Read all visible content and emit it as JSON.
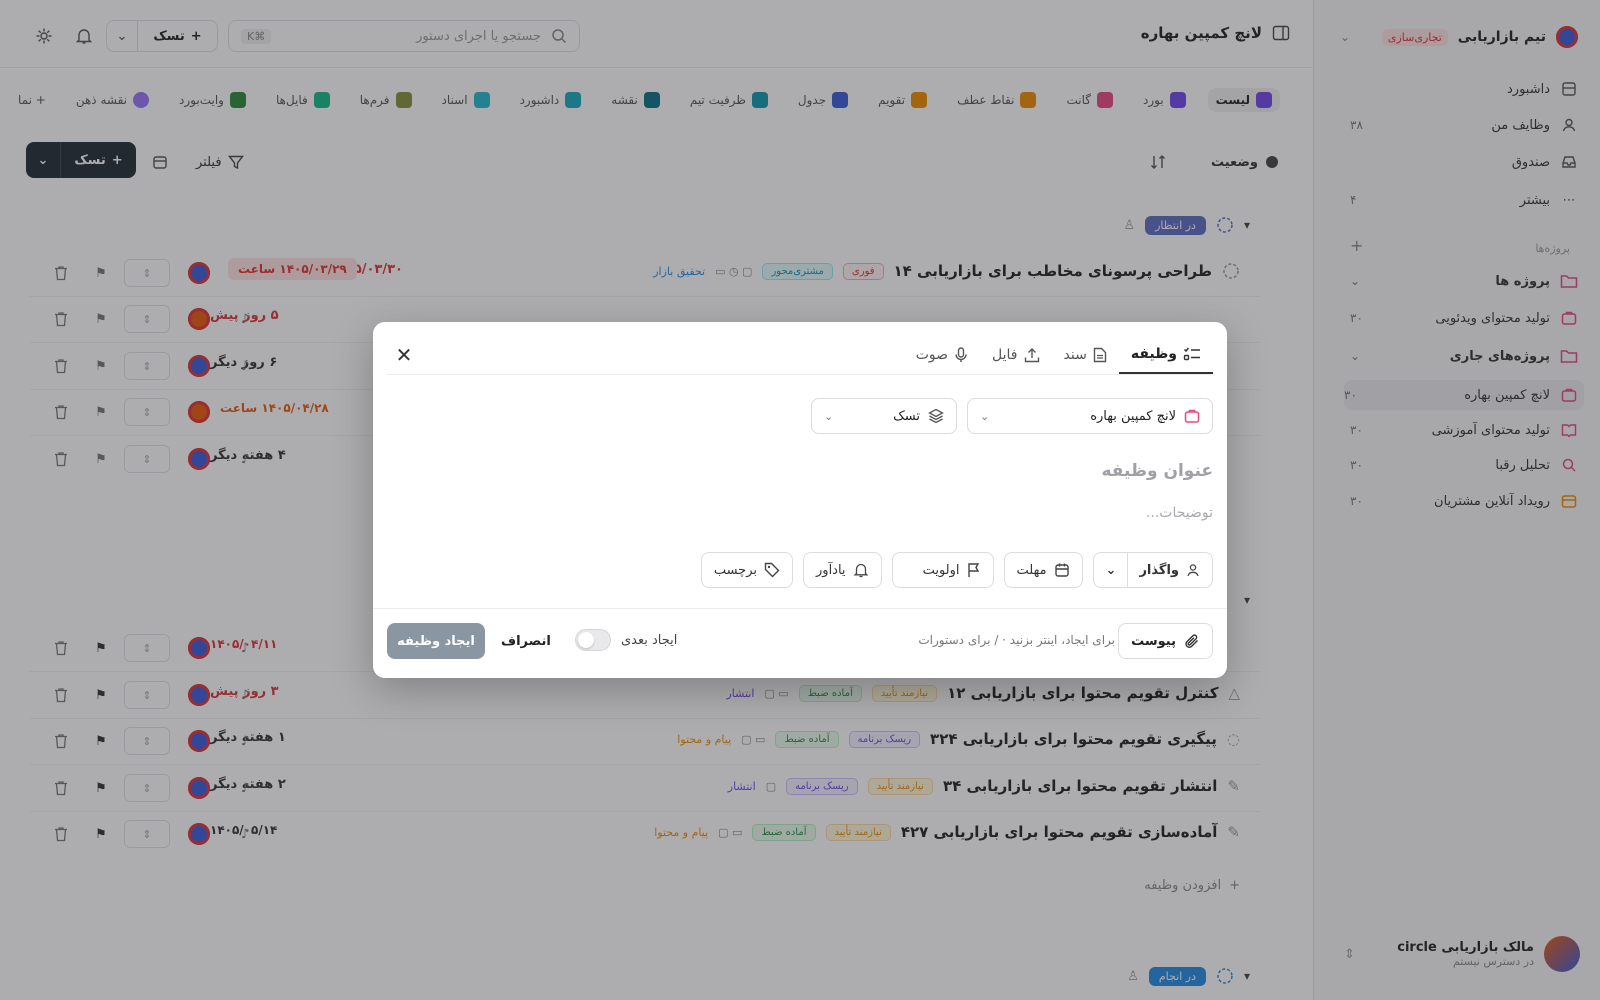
{
  "sidebar": {
    "workspace_name": "تیم بازاریابی",
    "workspace_badge": "تجاری‌سازی",
    "nav": [
      {
        "label": "داشبورد",
        "count": ""
      },
      {
        "label": "وظایف من",
        "count": "۳۸"
      },
      {
        "label": "صندوق",
        "count": ""
      },
      {
        "label": "بیشتر",
        "count": "۴"
      }
    ],
    "section_label": "پروژه‌ها",
    "folders": [
      {
        "label": "پروژه ها"
      },
      {
        "label": "پروژه‌های جاری"
      }
    ],
    "projects": [
      {
        "label": "تولید محتوای ویدئویی",
        "count": "۳۰",
        "color": "#e64980"
      },
      {
        "label": "لانچ کمپین بهاره",
        "count": "۳۰",
        "color": "#e64980"
      },
      {
        "label": "تولید محتوای آموزشی",
        "count": "۳۰",
        "color": "#e64980"
      },
      {
        "label": "تحلیل رقبا",
        "count": "۳۰",
        "color": "#e64980"
      },
      {
        "label": "رویداد آنلاین مشتریان",
        "count": "۳۰",
        "color": "#f08c00"
      }
    ],
    "user_name": "مالک بازاریابی circle",
    "user_role": "در دسترس نیستم"
  },
  "topbar": {
    "title": "لانچ کمپین بهاره",
    "search_placeholder": "جستجو یا اجرای دستور",
    "search_kbd": "⌘K",
    "new_label": "تسک"
  },
  "views": [
    {
      "label": "لیست",
      "color": "#7048e8",
      "active": true
    },
    {
      "label": "بورد",
      "color": "#7048e8"
    },
    {
      "label": "گانت",
      "color": "#e64980"
    },
    {
      "label": "نقاط عطف",
      "color": "#f08c00"
    },
    {
      "label": "تقویم",
      "color": "#f08c00"
    },
    {
      "label": "جدول",
      "color": "#3b5bdb"
    },
    {
      "label": "ظرفیت تیم",
      "color": "#1098ad"
    },
    {
      "label": "نقشه",
      "color": "#0b7285"
    },
    {
      "label": "داشبورد",
      "color": "#15aabf"
    },
    {
      "label": "اسناد",
      "color": "#22b8cf"
    },
    {
      "label": "فرم‌ها",
      "color": "#868e3e"
    },
    {
      "label": "فایل‌ها",
      "color": "#12b886"
    },
    {
      "label": "وایت‌بورد",
      "color": "#2b8a3e"
    },
    {
      "label": "نقشه ذهن",
      "color": "#9775fa"
    },
    {
      "label": "+ نما",
      "color": ""
    }
  ],
  "toolbar": {
    "status_label": "وضعیت",
    "filter_label": "فیلتر",
    "add_label": "تسک"
  },
  "groups": [
    {
      "label": "در انتظار",
      "color": "#5c6bc0"
    },
    {
      "label": "در انجام",
      "color": "#228be6"
    }
  ],
  "rows_top": [
    {
      "title": "طراحی پرسونای مخاطب برای بازاریابی ۱۴",
      "tag1": "فوری",
      "tag2": "مشتری‌محور",
      "link": "تحقیق بازار",
      "due": "۱۴۰۵/۰۳/۳۰",
      "pill": "۱۴۰۵/۰۳/۲۹ ساعت"
    },
    {
      "title": "",
      "due": "۵ روز پیش",
      "due_color": "#e03131"
    },
    {
      "title": "",
      "due": "۶ روز دیگر",
      "due_color": "#333"
    },
    {
      "title": "",
      "due": "۱۴۰۵/۰۴/۲۸ ساعت",
      "due_color": "#e8590c"
    },
    {
      "title": "",
      "due": "۴ هفته دیگر",
      "due_color": "#333"
    }
  ],
  "rows_bottom": [
    {
      "title": "",
      "due": "۱۴۰۵/۰۴/۱۱",
      "due_color": "#e03131"
    },
    {
      "title": "کنترل تقویم محتوا برای بازاریابی ۱۲",
      "tag1": "نیازمند تأیید",
      "tag2": "آماده ضبط",
      "link": "انتشار",
      "due": "۳ روز پیش",
      "due_color": "#e03131"
    },
    {
      "title": "پیگیری تقویم محتوا برای بازاریابی ۳۲۴",
      "tag1": "ریسک برنامه",
      "tag2": "آماده ضبط",
      "link": "پیام و محتوا",
      "due": "۱ هفته دیگر",
      "due_color": "#333"
    },
    {
      "title": "انتشار تقویم محتوا برای بازاریابی ۳۴",
      "tag1": "نیازمند تأیید",
      "tag2": "ریسک برنامه",
      "link": "انتشار",
      "due": "۲ هفته دیگر",
      "due_color": "#333"
    },
    {
      "title": "آماده‌سازی تقویم محتوا برای بازاریابی ۴۲۷",
      "tag1": "نیازمند تأیید",
      "tag2": "آماده ضبط",
      "link": "پیام و محتوا",
      "due": "۱۴۰۵/۰۵/۱۴",
      "due_color": "#333"
    }
  ],
  "add_task_label": "افزودن وظیفه",
  "modal": {
    "tabs": [
      {
        "label": "وظیفه",
        "icon": "task-list-icon",
        "active": true
      },
      {
        "label": "سند",
        "icon": "document-icon"
      },
      {
        "label": "فایل",
        "icon": "upload-icon"
      },
      {
        "label": "صوت",
        "icon": "microphone-icon"
      }
    ],
    "project_value": "لانچ کمپین بهاره",
    "type_value": "تسک",
    "title_placeholder": "عنوان وظیفه",
    "description_placeholder": "توضیحات...",
    "assign_label": "واگذار",
    "due_label": "مهلت",
    "priority_label": "اولویت",
    "reminder_label": "یادآور",
    "tag_label": "برچسب",
    "attach_label": "پیوست",
    "hint": "برای ایجاد، اینتر بزنید ⋅ / برای دستورات",
    "create_next_label": "ایجاد بعدی",
    "cancel_label": "انصراف",
    "create_label": "ایجاد وظیفه"
  }
}
